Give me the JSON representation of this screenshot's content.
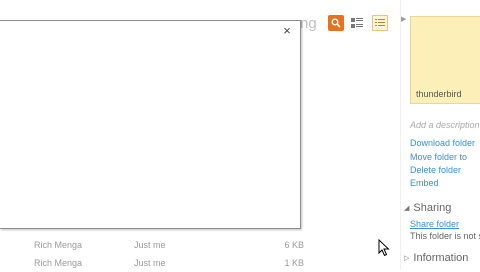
{
  "toolbar": {
    "search_partial_text": "ng",
    "icons": [
      "search-icon",
      "details-view-icon",
      "list-view-icon"
    ],
    "accent": "#e8711e"
  },
  "files": [
    {
      "owner": "Rich Menga",
      "modified": "Just me",
      "size": "6 KB"
    },
    {
      "owner": "Rich Menga",
      "modified": "Just me",
      "size": "1 KB"
    }
  ],
  "dialog": {
    "close_label": "×"
  },
  "details": {
    "folder_name": "thunderbird",
    "add_description": "Add a description",
    "actions": [
      "Download folder",
      "Move folder to",
      "Delete folder",
      "Embed"
    ],
    "sharing": {
      "heading": "Sharing",
      "share_link": "Share folder",
      "note": "This folder is not sh"
    },
    "information_heading": "Information",
    "link_color": "#3a8fd6"
  }
}
